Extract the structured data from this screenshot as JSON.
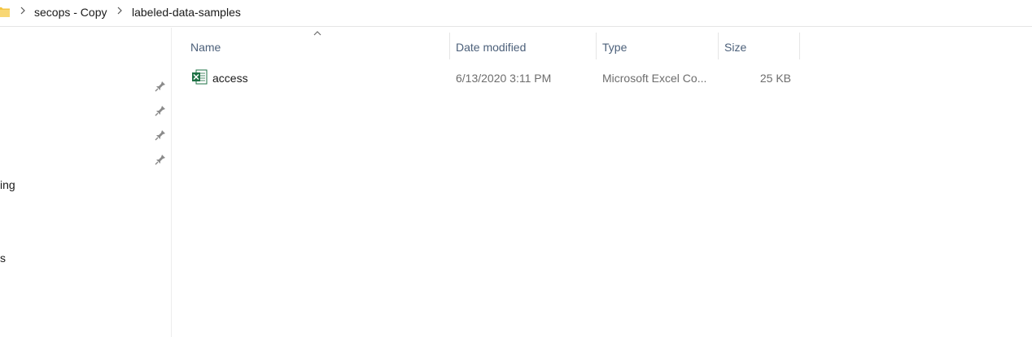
{
  "breadcrumb": {
    "items": [
      "secops - Copy",
      "labeled-data-samples"
    ]
  },
  "nav": {
    "partial_labels": [
      "ing",
      "s"
    ]
  },
  "columns": {
    "name": "Name",
    "date_modified": "Date modified",
    "type": "Type",
    "size": "Size"
  },
  "files": [
    {
      "name": "access",
      "date_modified": "6/13/2020 3:11 PM",
      "type": "Microsoft Excel Co...",
      "size": "25 KB",
      "icon": "excel-file-icon"
    }
  ],
  "colors": {
    "folder": "#f4c542",
    "excel_green": "#1e7145",
    "header_text": "#4c607a"
  }
}
